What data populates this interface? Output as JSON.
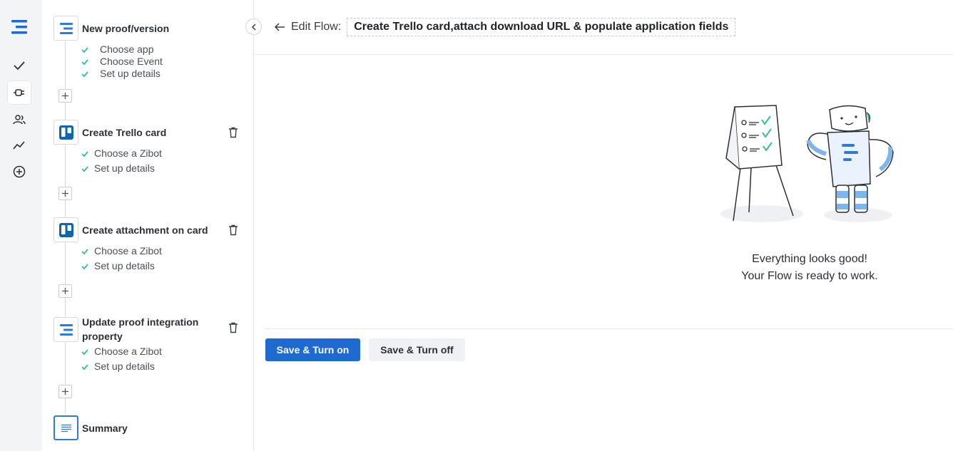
{
  "rail": {
    "items": [
      "logo-icon",
      "check-icon",
      "plug-icon",
      "users-icon",
      "activity-icon",
      "add-circle-icon"
    ]
  },
  "steps": [
    {
      "title": "New proof/version",
      "subs": [
        "Choose app",
        "Choose Event",
        "Set up details"
      ]
    },
    {
      "title": "Create Trello card",
      "subs": [
        "Choose a Zibot",
        "Set up details"
      ]
    },
    {
      "title": "Create attachment on card",
      "subs": [
        "Choose a Zibot",
        "Set up details"
      ]
    },
    {
      "title_line1": "Update proof integration",
      "title_line2": "property",
      "subs": [
        "Choose a Zibot",
        "Set up details"
      ]
    },
    {
      "title": "Summary"
    }
  ],
  "header": {
    "edit_label": "Edit Flow:",
    "flow_name": "Create Trello card,attach download URL & populate application fields"
  },
  "status": {
    "line1": "Everything looks good!",
    "line2": "Your Flow is ready to work."
  },
  "buttons": {
    "save_on": "Save & Turn on",
    "save_off": "Save & Turn off"
  },
  "colors": {
    "primary": "#1f6ad1",
    "check": "#2fc28e",
    "trello": "#0c66b0",
    "brand": "#2d7ad8"
  }
}
